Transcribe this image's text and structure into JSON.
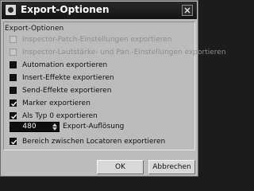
{
  "window": {
    "title": "Export-Optionen",
    "icon": "app-icon",
    "close_icon": "close-icon"
  },
  "group": {
    "title": "Export-Optionen"
  },
  "options": [
    {
      "label": "Inspector-Patch-Einstellungen exportieren",
      "state": "disabled"
    },
    {
      "label": "Inspector-Lautstärke- und Pan.-Einstellungen exportieren",
      "state": "disabled"
    },
    {
      "label": "Automation exportieren",
      "state": "unchecked"
    },
    {
      "label": "Insert-Effekte exportieren",
      "state": "unchecked"
    },
    {
      "label": "Send-Effekte exportieren",
      "state": "unchecked"
    },
    {
      "label": "Marker exportieren",
      "state": "checked"
    },
    {
      "label": "Als Typ 0 exportieren",
      "state": "checked"
    },
    {
      "label": "Bereich zwischen Locatoren exportieren",
      "state": "checked"
    }
  ],
  "resolution": {
    "value": "480",
    "label": "Export-Auflösung"
  },
  "buttons": {
    "ok": "OK",
    "cancel": "Abbrechen"
  },
  "colors": {
    "titlebar": "#1a1a1a",
    "dialog_bg": "#bcbcbc",
    "checkbox_fill": "#111111"
  }
}
